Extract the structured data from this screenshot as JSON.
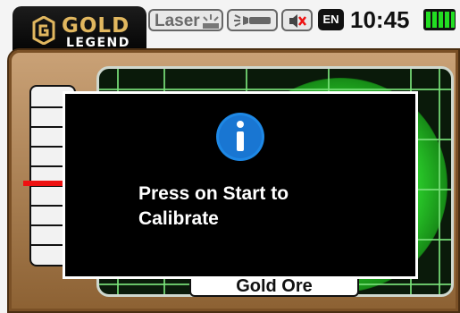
{
  "header": {
    "logo_line1": "GOLD",
    "logo_line2": "LEGEND",
    "laser_label": "Laser",
    "language": "EN",
    "time": "10:45"
  },
  "detector": {
    "target_label": "Gold Ore"
  },
  "dialog": {
    "icon": "info-icon",
    "message": "Press on Start to\nCalibrate"
  },
  "colors": {
    "accent_gold": "#e1b75f",
    "panel_amber": "#b88a5a",
    "signal_green": "#3ae03a",
    "indicator_red": "#ee1111",
    "battery_green": "#22dd22"
  }
}
